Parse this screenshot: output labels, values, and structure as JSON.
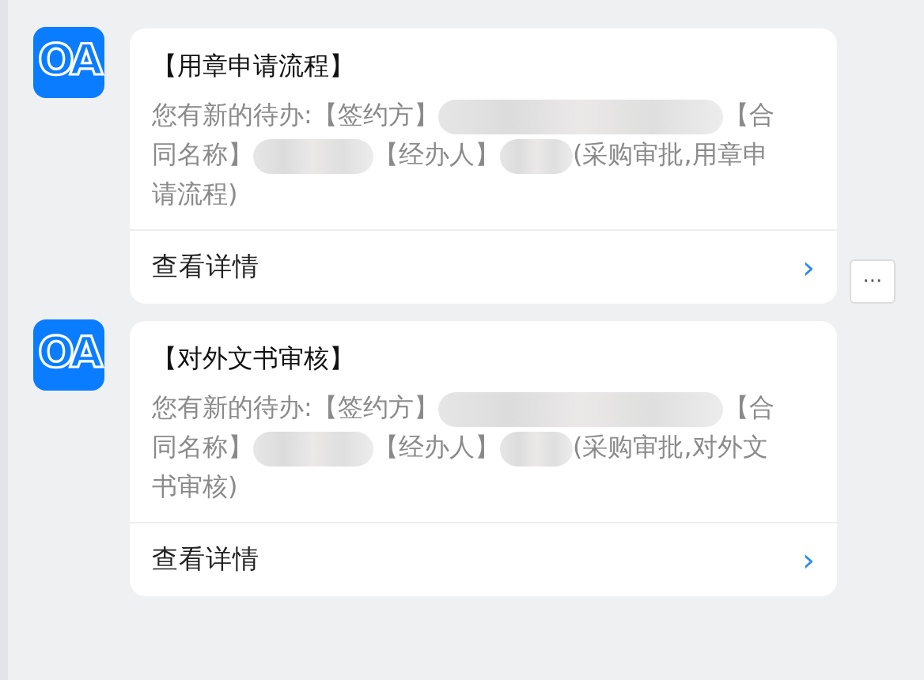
{
  "messages": [
    {
      "logo": "OA",
      "title": "【用章申请流程】",
      "body": [
        {
          "kind": "text",
          "text": "您有新的待办:【签约方】"
        },
        {
          "kind": "redacted"
        },
        {
          "kind": "text",
          "text": "【合"
        },
        {
          "kind": "text",
          "text": "同名称】"
        },
        {
          "kind": "redacted"
        },
        {
          "kind": "text",
          "text": "【经办人】"
        },
        {
          "kind": "redacted"
        },
        {
          "kind": "text",
          "text": "(采购审批,用章申"
        },
        {
          "kind": "text",
          "text": "请流程)"
        }
      ],
      "link": "查看详情",
      "chevron": "›",
      "more": "···"
    },
    {
      "logo": "OA",
      "title": "【对外文书审核】",
      "body": [
        {
          "kind": "text",
          "text": "您有新的待办:【签约方】"
        },
        {
          "kind": "redacted"
        },
        {
          "kind": "text",
          "text": "【合"
        },
        {
          "kind": "text",
          "text": "同名称】"
        },
        {
          "kind": "redacted"
        },
        {
          "kind": "text",
          "text": "【经办人】"
        },
        {
          "kind": "redacted"
        },
        {
          "kind": "text",
          "text": "(采购审批,对外文"
        },
        {
          "kind": "text",
          "text": "书审核)"
        }
      ],
      "link": "查看详情",
      "chevron": "›"
    }
  ]
}
